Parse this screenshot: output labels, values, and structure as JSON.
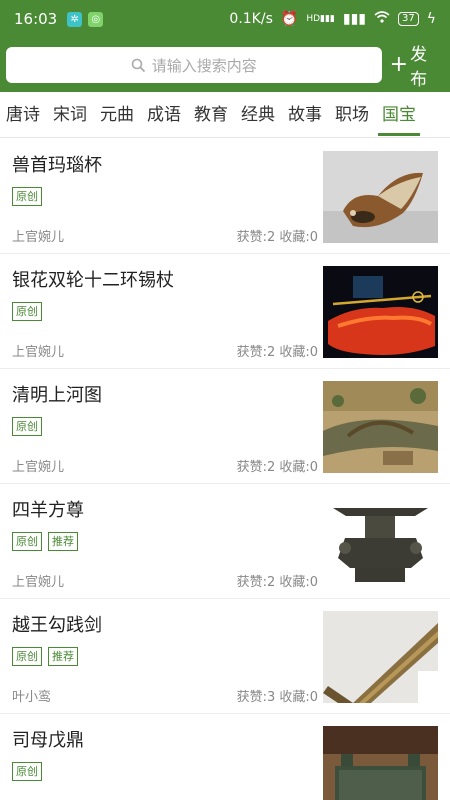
{
  "status_bar": {
    "time": "16:03",
    "network_speed": "0.1K/s",
    "signal": "HD",
    "battery": "37"
  },
  "search": {
    "placeholder": "请输入搜索内容"
  },
  "header": {
    "publish_label": "发布"
  },
  "tabs": [
    {
      "label": "唐诗"
    },
    {
      "label": "宋词"
    },
    {
      "label": "元曲"
    },
    {
      "label": "成语"
    },
    {
      "label": "教育"
    },
    {
      "label": "经典"
    },
    {
      "label": "故事"
    },
    {
      "label": "职场"
    },
    {
      "label": "国宝"
    }
  ],
  "active_tab": "国宝",
  "items": [
    {
      "title": "兽首玛瑙杯",
      "tags": [
        "原创"
      ],
      "author": "上官婉儿",
      "stats": "获赞:2 收藏:0",
      "image": "agate-cup"
    },
    {
      "title": "银花双轮十二环锡杖",
      "tags": [
        "原创"
      ],
      "author": "上官婉儿",
      "stats": "获赞:2 收藏:0",
      "image": "tin-staff"
    },
    {
      "title": "清明上河图",
      "tags": [
        "原创"
      ],
      "author": "上官婉儿",
      "stats": "获赞:2 收藏:0",
      "image": "qingming-painting"
    },
    {
      "title": "四羊方尊",
      "tags": [
        "原创",
        "推荐"
      ],
      "author": "上官婉儿",
      "stats": "获赞:2 收藏:0",
      "image": "four-ram-zun"
    },
    {
      "title": "越王勾践剑",
      "tags": [
        "原创",
        "推荐"
      ],
      "author": "叶小鸾",
      "stats": "获赞:3 收藏:0",
      "image": "goujian-sword"
    },
    {
      "title": "司母戊鼎",
      "tags": [
        "原创"
      ],
      "author": "",
      "stats": "",
      "image": "simuwu-ding"
    }
  ],
  "colors": {
    "brand": "#4a8a35",
    "tag_border": "#4a8a35",
    "meta_text": "#888888"
  }
}
